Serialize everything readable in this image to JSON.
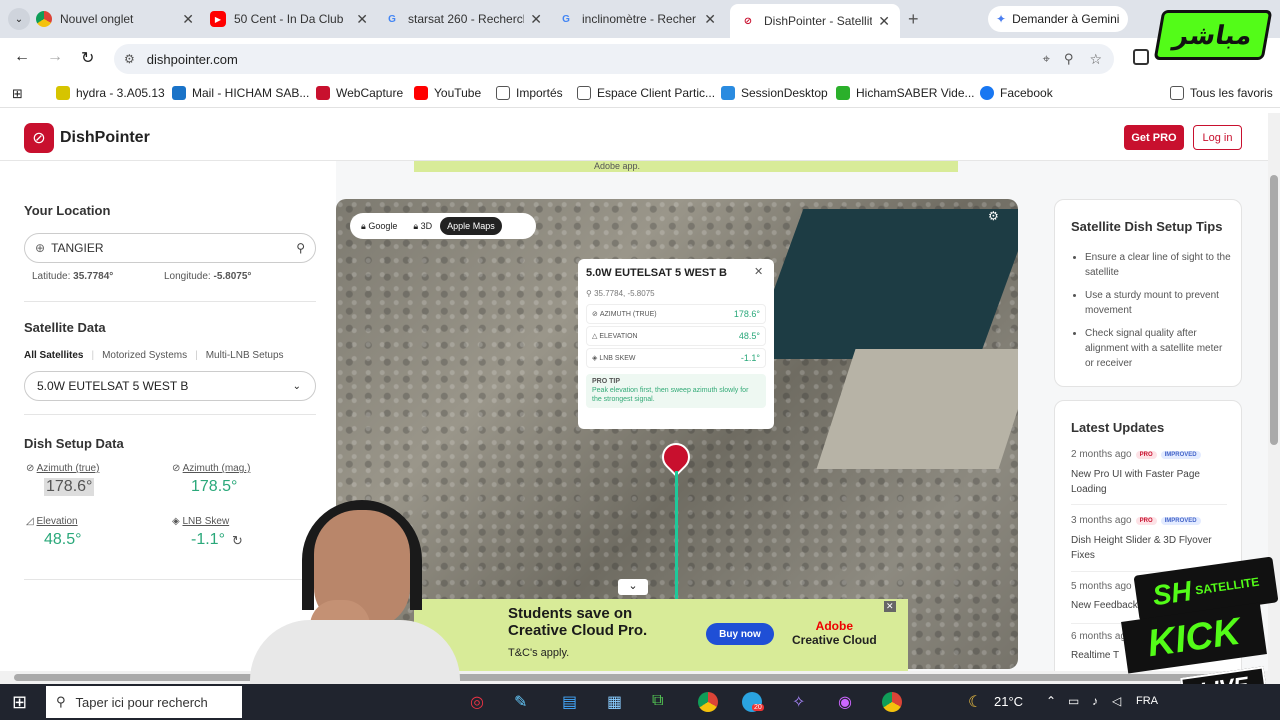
{
  "tabs": [
    {
      "title": "Nouvel onglet",
      "icon": "chrome-icon"
    },
    {
      "title": "50 Cent - In Da Club",
      "icon": "youtube-icon"
    },
    {
      "title": "starsat 260 - Recherch",
      "icon": "google-icon"
    },
    {
      "title": "inclinomètre - Recher",
      "icon": "google-icon"
    },
    {
      "title": "DishPointer - Satellite",
      "icon": "dishpointer-icon"
    }
  ],
  "gemini_label": "Demander à Gemini",
  "url": "dishpointer.com",
  "bookmarks": [
    "hydra - 3.A05.13",
    "Mail - HICHAM SAB...",
    "WebCapture",
    "YouTube",
    "Importés",
    "Espace Client Partic...",
    "SessionDesktop",
    "HichamSABER Vide...",
    "Facebook"
  ],
  "all_bookmarks": "Tous les favoris",
  "site": {
    "brand": "DishPointer",
    "get_pro": "Get PRO",
    "login": "Log in",
    "top_banner_text": "Adobe app."
  },
  "location": {
    "title": "Your Location",
    "value": "TANGIER",
    "lat_label": "Latitude:",
    "lat": "35.7784°",
    "lon_label": "Longitude:",
    "lon": "-5.8075°"
  },
  "satellite": {
    "title": "Satellite Data",
    "tabs": [
      "All Satellites",
      "Motorized Systems",
      "Multi-LNB Setups"
    ],
    "selected": "5.0W EUTELSAT 5 WEST B"
  },
  "dish": {
    "title": "Dish Setup Data",
    "az_true_label": "Azimuth (true)",
    "az_true": "178.6°",
    "az_mag_label": "Azimuth (mag.)",
    "az_mag": "178.5°",
    "elev_label": "Elevation",
    "elev": "48.5°",
    "skew_label": "LNB Skew",
    "skew": "-1.1°"
  },
  "map": {
    "modes": [
      "Google",
      "3D",
      "Apple Maps"
    ],
    "popup_title": "5.0W EUTELSAT 5 WEST B",
    "coords": "35.7784, -5.8075",
    "rows": [
      {
        "label": "AZIMUTH (TRUE)",
        "value": "178.6°"
      },
      {
        "label": "ELEVATION",
        "value": "48.5°"
      },
      {
        "label": "LNB SKEW",
        "value": "-1.1°"
      }
    ],
    "tip_title": "PRO TIP",
    "tip_text": "Peak elevation first, then sweep azimuth slowly for the strongest signal."
  },
  "ad": {
    "line1": "Students save on",
    "line2": "Creative Cloud Pro.",
    "tc": "T&C's apply.",
    "buy": "Buy now",
    "brand1": "Adobe",
    "brand2": "Creative Cloud"
  },
  "tips": {
    "title": "Satellite Dish Setup Tips",
    "items": [
      "Ensure a clear line of sight to the satellite",
      "Use a sturdy mount to prevent movement",
      "Check signal quality after alignment with a satellite meter or receiver"
    ]
  },
  "updates": {
    "title": "Latest Updates",
    "items": [
      {
        "time": "2 months ago",
        "badges": [
          "PRO",
          "IMPROVED"
        ],
        "text": "New Pro UI with Faster Page Loading"
      },
      {
        "time": "3 months ago",
        "badges": [
          "PRO",
          "IMPROVED"
        ],
        "text": "Dish Height Slider & 3D Flyover Fixes"
      },
      {
        "time": "5 months ago",
        "badges": [],
        "text": "New Feedback"
      },
      {
        "time": "6 months ago",
        "badges": [],
        "text": "Realtime T"
      }
    ]
  },
  "overlay": {
    "mubasher": "مباشر",
    "sh": "SH",
    "satellite": "SATELLITE",
    "kick": "KICK",
    "live": "LIVE"
  },
  "taskbar": {
    "search": "Taper ici pour recherch",
    "temp": "21°C",
    "lang": "FRA",
    "badge": "20"
  },
  "colors": {
    "brand_red": "#c8102e",
    "green": "#2aa87a",
    "kick_green": "#53fc18"
  }
}
